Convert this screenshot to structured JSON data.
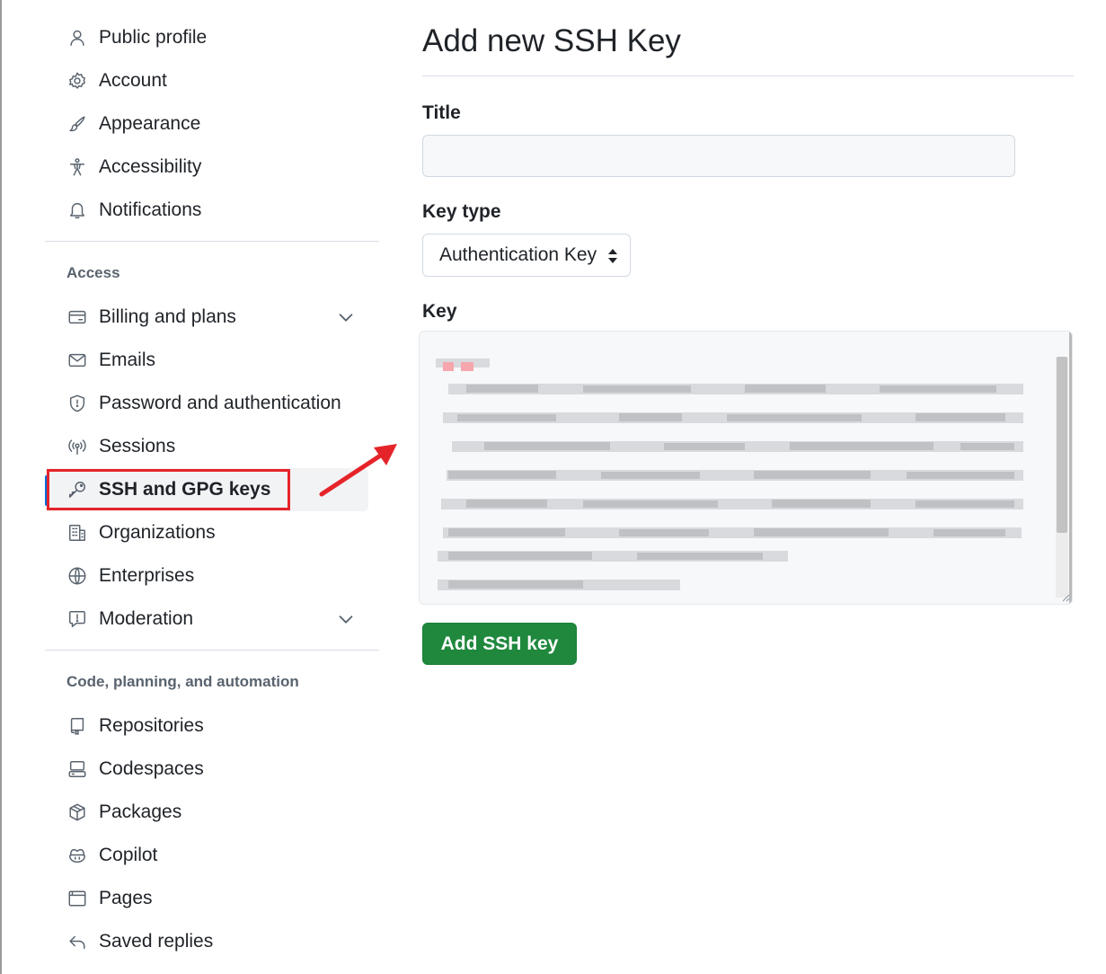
{
  "sidebar": {
    "group1": [
      {
        "label": "Public profile",
        "icon": "person-icon"
      },
      {
        "label": "Account",
        "icon": "gear-icon"
      },
      {
        "label": "Appearance",
        "icon": "paintbrush-icon"
      },
      {
        "label": "Accessibility",
        "icon": "accessibility-icon"
      },
      {
        "label": "Notifications",
        "icon": "bell-icon"
      }
    ],
    "access_heading": "Access",
    "access": [
      {
        "label": "Billing and plans",
        "icon": "credit-card-icon",
        "expandable": true
      },
      {
        "label": "Emails",
        "icon": "mail-icon"
      },
      {
        "label": "Password and authentication",
        "icon": "shield-icon"
      },
      {
        "label": "Sessions",
        "icon": "broadcast-icon"
      },
      {
        "label": "SSH and GPG keys",
        "icon": "key-icon",
        "active": true
      },
      {
        "label": "Organizations",
        "icon": "organization-icon"
      },
      {
        "label": "Enterprises",
        "icon": "globe-icon"
      },
      {
        "label": "Moderation",
        "icon": "report-icon",
        "expandable": true
      }
    ],
    "code_heading": "Code, planning, and automation",
    "code": [
      {
        "label": "Repositories",
        "icon": "repo-icon"
      },
      {
        "label": "Codespaces",
        "icon": "codespaces-icon"
      },
      {
        "label": "Packages",
        "icon": "package-icon"
      },
      {
        "label": "Copilot",
        "icon": "copilot-icon"
      },
      {
        "label": "Pages",
        "icon": "browser-icon"
      },
      {
        "label": "Saved replies",
        "icon": "reply-icon"
      }
    ]
  },
  "main": {
    "title": "Add new SSH Key",
    "title_field_label": "Title",
    "title_value": "",
    "key_type_label": "Key type",
    "key_type_value": "Authentication Key",
    "key_label": "Key",
    "submit_label": "Add SSH key"
  },
  "colors": {
    "accent_blue": "#0969da",
    "primary_green": "#1f883d",
    "annotation_red": "#e5242a"
  }
}
